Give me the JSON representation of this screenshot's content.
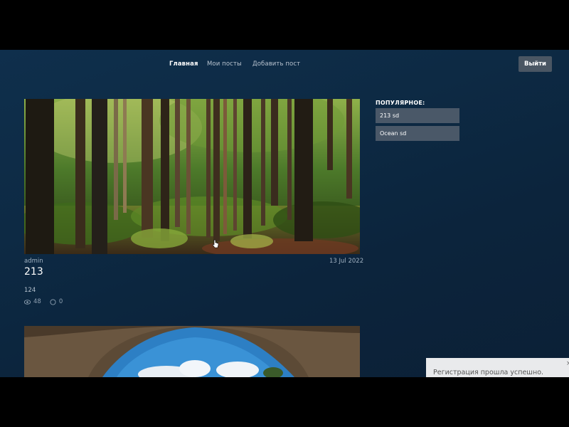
{
  "nav": {
    "links": [
      {
        "label": "Главная",
        "active": true
      },
      {
        "label": "Мои посты",
        "active": false
      },
      {
        "label": "Добавить пост",
        "active": false
      }
    ],
    "logout_label": "Выйти"
  },
  "posts": [
    {
      "author": "admin",
      "date": "13 Jul 2022",
      "title": "213",
      "text": "124",
      "views": "48",
      "comments": "0",
      "image": "forest-photo"
    },
    {
      "image": "cave-sky-photo"
    }
  ],
  "popular": {
    "title": "ПОПУЛЯРНОЕ:",
    "items": [
      "213 sd",
      "Ocean sd"
    ]
  },
  "toast": {
    "message": "Регистрация прошла успешно.",
    "close": "×"
  },
  "colors": {
    "background": "#0d2a44",
    "popular_item": "#4a5868",
    "logout_button": "#4a5663",
    "toast_bg": "#e9eaec"
  },
  "icons": [
    "eye-icon",
    "comment-icon",
    "close-icon",
    "cursor-icon"
  ]
}
